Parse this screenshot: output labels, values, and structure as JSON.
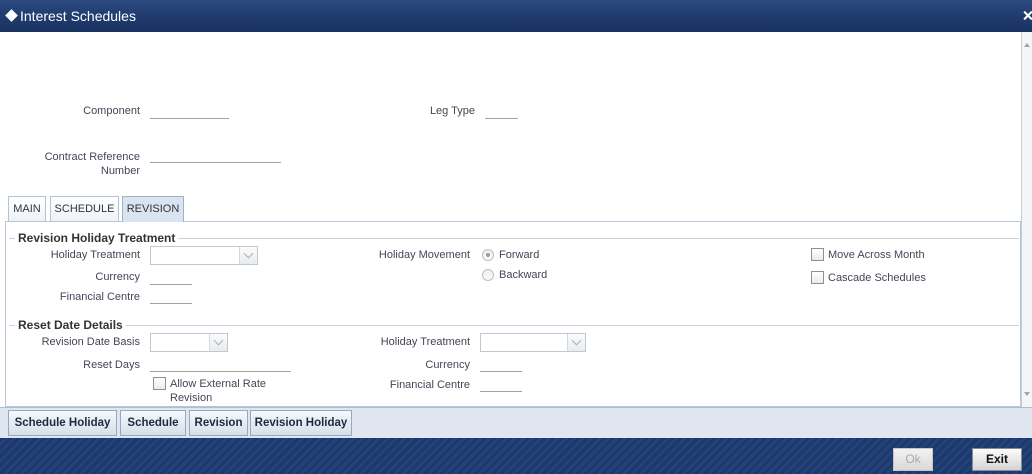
{
  "window": {
    "title": "Interest Schedules"
  },
  "header": {
    "component": {
      "label": "Component",
      "value": ""
    },
    "leg_type": {
      "label": "Leg Type",
      "value": ""
    },
    "contract_reference": {
      "label": "Contract Reference Number",
      "value": ""
    }
  },
  "tabs": [
    {
      "label": "MAIN",
      "active": false
    },
    {
      "label": "SCHEDULE",
      "active": false
    },
    {
      "label": "REVISION",
      "active": true
    }
  ],
  "revision_holiday": {
    "heading": "Revision Holiday Treatment",
    "holiday_treatment": {
      "label": "Holiday Treatment",
      "value": ""
    },
    "currency": {
      "label": "Currency",
      "value": ""
    },
    "financial_centre": {
      "label": "Financial Centre",
      "value": ""
    },
    "holiday_movement": {
      "label": "Holiday Movement",
      "options": [
        {
          "label": "Forward",
          "selected": true
        },
        {
          "label": "Backward",
          "selected": false
        }
      ]
    },
    "move_across_month": {
      "label": "Move Across Month",
      "checked": false
    },
    "cascade_schedules": {
      "label": "Cascade Schedules",
      "checked": false
    }
  },
  "reset_date": {
    "heading": "Reset Date Details",
    "revision_date_basis": {
      "label": "Revision Date Basis",
      "value": ""
    },
    "reset_days": {
      "label": "Reset Days",
      "value": ""
    },
    "allow_external_rate_revision": {
      "label": "Allow External Rate Revision",
      "checked": false
    },
    "holiday_treatment": {
      "label": "Holiday Treatment",
      "value": ""
    },
    "currency": {
      "label": "Currency",
      "value": ""
    },
    "financial_centre": {
      "label": "Financial Centre",
      "value": ""
    }
  },
  "subscreen_buttons": [
    {
      "label": "Schedule Holiday"
    },
    {
      "label": "Schedule"
    },
    {
      "label": "Revision"
    },
    {
      "label": "Revision Holiday"
    }
  ],
  "footer": {
    "ok_label": "Ok",
    "ok_disabled": true,
    "exit_label": "Exit"
  },
  "icons": {
    "title": "diamond-icon",
    "close": "close-icon",
    "dropdown": "chevron-down-icon",
    "scroll_up": "scroll-up-arrow-icon",
    "scroll_down": "scroll-down-arrow-icon"
  },
  "colors": {
    "title_bar": "#1f3b6d",
    "footer_bar": "#1d386a",
    "active_tab": "#d9e4f2",
    "button_bar": "#dfe6ef",
    "label_text": "#454557",
    "disabled_text": "#a9a9a9"
  }
}
